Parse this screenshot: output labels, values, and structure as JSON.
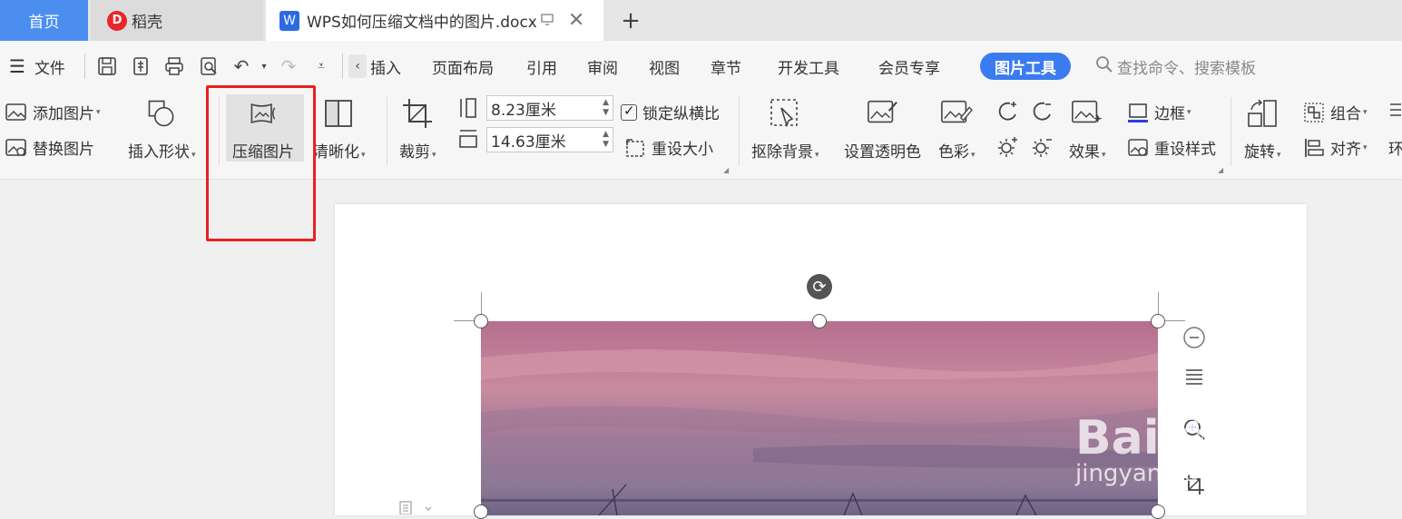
{
  "tabs": {
    "home": "首页",
    "daoke": "稻壳",
    "doc": "WPS如何压缩文档中的图片.docx",
    "add": "+"
  },
  "menu": {
    "file": "文件",
    "items": [
      "插入",
      "页面布局",
      "引用",
      "审阅",
      "视图",
      "章节",
      "开发工具",
      "会员专享"
    ],
    "picture_tools": "图片工具",
    "search_placeholder": "查找命令、搜索模板"
  },
  "ribbon": {
    "add_picture": "添加图片",
    "replace_picture": "替换图片",
    "insert_shape": "插入形状",
    "compress_picture": "压缩图片",
    "clarify": "清晰化",
    "crop": "裁剪",
    "height_value": "8.23厘米",
    "width_value": "14.63厘米",
    "lock_ratio": "锁定纵横比",
    "reset_size": "重设大小",
    "remove_bg": "抠除背景",
    "set_transparent": "设置透明色",
    "color": "色彩",
    "effects": "效果",
    "border": "边框",
    "reset_style": "重设样式",
    "rotate": "旋转",
    "group": "组合",
    "align": "对齐",
    "wrap_partial": "环"
  },
  "watermark": {
    "line1": "Bai经验",
    "line2": "jingyan.baidu.com"
  },
  "colors": {
    "accent": "#3a7cf0",
    "home_tab": "#4b8ef0",
    "highlight_box": "#e82020"
  }
}
